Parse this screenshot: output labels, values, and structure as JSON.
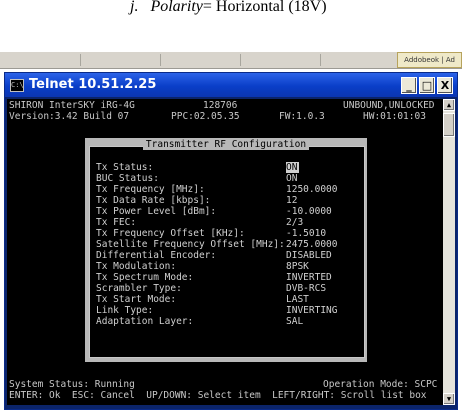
{
  "document": {
    "caption_index": "j.",
    "caption_term": "Polarity",
    "caption_rest": "= Horizontal (18V)"
  },
  "background_tab": {
    "label": "Addobeok | Ad"
  },
  "window": {
    "title": "Telnet 10.51.2.25",
    "icon": "cmd-icon",
    "controls": {
      "minimize": "_",
      "maximize": "□",
      "close": "X"
    }
  },
  "header": {
    "product": "SHIRON InterSKY iRG-4G",
    "version": "Version:3.42 Build 07",
    "center_top": "128706",
    "ppc": "PPC:02.05.35",
    "fw": "FW:1.0.3",
    "status": "UNBOUND,UNLOCKED",
    "hw": "HW:01:01:03"
  },
  "dialog": {
    "title": "Transmitter RF Configuration",
    "fields": [
      {
        "label": "Tx Status:",
        "value": "ON"
      },
      {
        "label": "BUC Status:",
        "value": "ON"
      },
      {
        "label": "Tx Frequency [MHz]:",
        "value": "1250.0000"
      },
      {
        "label": "Tx Data Rate [kbps]:",
        "value": "12"
      },
      {
        "label": "Tx Power Level [dBm]:",
        "value": "-10.0000"
      },
      {
        "label": "Tx FEC:",
        "value": "2/3"
      },
      {
        "label": "Tx Frequency Offset [KHz]:",
        "value": "-1.5010"
      },
      {
        "label": "Satellite Frequency Offset [MHz]:",
        "value": "2475.0000"
      },
      {
        "label": "Differential Encoder:",
        "value": "DISABLED"
      },
      {
        "label": "Tx Modulation:",
        "value": "8PSK"
      },
      {
        "label": "Tx Spectrum Mode:",
        "value": "INVERTED"
      },
      {
        "label": "Scrambler Type:",
        "value": "DVB-RCS"
      },
      {
        "label": "Tx Start Mode:",
        "value": "LAST"
      },
      {
        "label": "Link Type:",
        "value": "INVERTING"
      },
      {
        "label": "Adaptation Layer:",
        "value": "SAL"
      }
    ]
  },
  "footer": {
    "system_status": "System Status: Running",
    "operation_mode": "Operation Mode: SCPC",
    "help": "ENTER: Ok  ESC: Cancel  UP/DOWN: Select item  LEFT/RIGHT: Scroll list box"
  },
  "colors": {
    "console_bg": "#000000",
    "console_text": "#c8c8c8",
    "dialog_frame": "#b8b8b8",
    "titlebar": "#0a3ec8"
  }
}
